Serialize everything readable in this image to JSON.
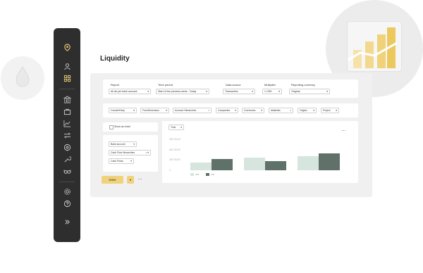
{
  "page_title": "Liquidity",
  "filters": {
    "report": {
      "label": "Report",
      "value": "All ab per bank account"
    },
    "time_period": {
      "label": "Time period",
      "value": "Start of the previous week - Today"
    },
    "data_source": {
      "label": "Data source",
      "value": "Transaction"
    },
    "multiplier": {
      "label": "Multiplier",
      "value": "1 USD"
    },
    "reporting_currency": {
      "label": "Reporting currency",
      "value": "Original"
    }
  },
  "dimension_chips": [
    "CounterParty",
    "FormDimension",
    "Account Hierarchies",
    "Companies",
    "Currencies",
    "Materials",
    "Origins",
    "Project"
  ],
  "show_as_chart_label": "Show as chart",
  "group_selects": [
    "Bank account",
    "Cash Flow Hierarchies",
    "Cash Flows"
  ],
  "save_label": "Save",
  "more_label": "…",
  "chart_period_select": "Time",
  "colors": {
    "sidebar": "#2e2e2e",
    "accent": "#efd27a",
    "series_light": "#d6e6de",
    "series_dark": "#5f7168"
  },
  "chart_data": {
    "type": "bar",
    "y_ticks": [
      "900 000,00",
      "600 000,00",
      "300 000,00",
      "0"
    ],
    "ylim": [
      0,
      900000
    ],
    "groups": 3,
    "series": [
      {
        "name": "CW",
        "values": [
          220000,
          370000,
          410000
        ]
      },
      {
        "name": "CW",
        "values": [
          320000,
          260000,
          500000
        ]
      }
    ]
  }
}
